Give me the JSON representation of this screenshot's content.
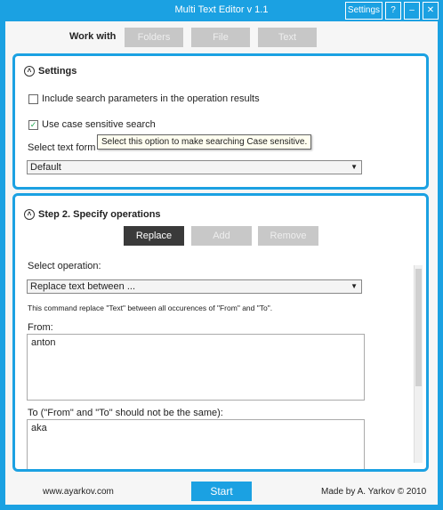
{
  "window": {
    "title": "Multi Text Editor v 1.1",
    "settings_label": "Settings",
    "help_label": "?",
    "minimize_label": "–",
    "close_label": "✕"
  },
  "workwith": {
    "label": "Work with",
    "buttons": [
      "Folders",
      "File",
      "Text"
    ]
  },
  "settings": {
    "title": "Settings",
    "include_label": "Include search parameters in the operation results",
    "case_label": "Use case sensitive search",
    "format_label": "Select text form",
    "format_value": "Default",
    "tooltip": "Select this option to make searching Case sensitive."
  },
  "step2": {
    "title": "Step 2. Specify operations",
    "buttons": [
      "Replace",
      "Add",
      "Remove"
    ],
    "select_label": "Select operation:",
    "operation_value": "Replace text between ...",
    "description": "This command replace \"Text\" between all occurences of \"From\" and \"To\".",
    "from_label": "From:",
    "from_value": "anton",
    "to_label": "To (\"From\" and \"To\" should not be the same):",
    "to_value": "aka"
  },
  "footer": {
    "site": "www.ayarkov.com",
    "start_label": "Start",
    "credit": "Made by A. Yarkov © 2010"
  }
}
